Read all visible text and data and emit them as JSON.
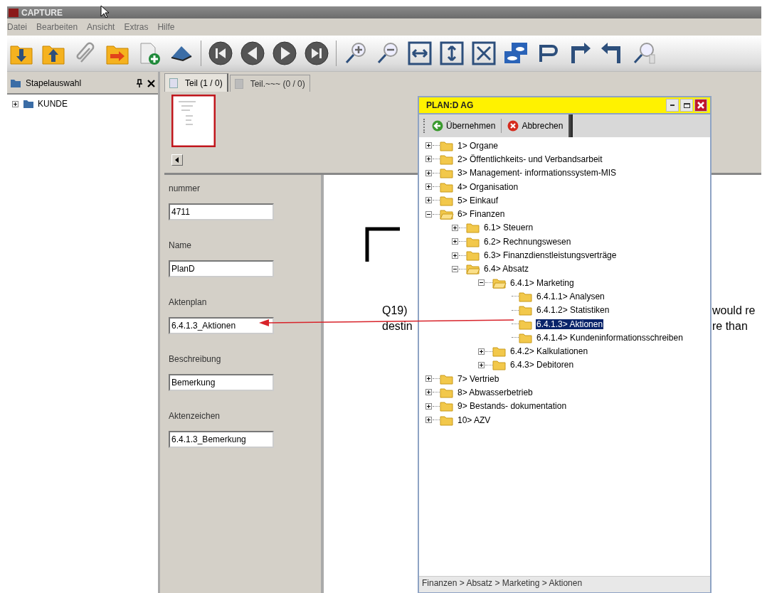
{
  "window": {
    "title": "CAPTURE"
  },
  "menu": [
    "Datei",
    "Bearbeiten",
    "Ansicht",
    "Extras",
    "Hilfe"
  ],
  "side_panel": {
    "title": "Stapelauswahl",
    "items": [
      {
        "label": "KUNDE",
        "expanded": false
      }
    ]
  },
  "tabs": [
    {
      "label": "Teil (1 / 0)",
      "selected": true
    },
    {
      "label": "Teil.~~~ (0 / 0)",
      "selected": false
    }
  ],
  "form": [
    {
      "label": "nummer",
      "value": "4711"
    },
    {
      "label": "Name",
      "value": "PlanD"
    },
    {
      "label": "Aktenplan",
      "value": "6.4.1.3_Aktionen"
    },
    {
      "label": "Beschreibung",
      "value": "Bemerkung"
    },
    {
      "label": "Aktenzeichen",
      "value": "6.4.1.3_Bemerkung"
    }
  ],
  "document": {
    "left_lines": [
      "Q19)",
      "destin"
    ],
    "right_lines": [
      "would re",
      "re than"
    ]
  },
  "dialog": {
    "title": "PLAN:D AG",
    "buttons": [
      {
        "label": "Übernehmen",
        "kind": "accept"
      },
      {
        "label": "Abbrechen",
        "kind": "cancel"
      }
    ],
    "tree": [
      {
        "label": "1> Organe",
        "expanded": false,
        "selected": false
      },
      {
        "label": "2> Öffentlichkeits- und Verbandsarbeit",
        "expanded": false,
        "selected": false
      },
      {
        "label": "3> Management- informationssystem-MIS",
        "expanded": false,
        "selected": false
      },
      {
        "label": "4> Organisation",
        "expanded": false,
        "selected": false
      },
      {
        "label": "5> Einkauf",
        "expanded": false,
        "selected": false
      },
      {
        "label": "6> Finanzen",
        "expanded": true,
        "selected": false,
        "children": [
          {
            "label": "6.1> Steuern",
            "expanded": false,
            "selected": false
          },
          {
            "label": "6.2> Rechnungswesen",
            "expanded": false,
            "selected": false
          },
          {
            "label": "6.3> Finanzdienstleistungsverträge",
            "expanded": false,
            "selected": false
          },
          {
            "label": "6.4> Absatz",
            "expanded": true,
            "selected": false,
            "children": [
              {
                "label": "6.4.1> Marketing",
                "expanded": true,
                "selected": false,
                "children": [
                  {
                    "label": "6.4.1.1> Analysen",
                    "selected": false
                  },
                  {
                    "label": "6.4.1.2> Statistiken",
                    "selected": false
                  },
                  {
                    "label": "6.4.1.3> Aktionen",
                    "selected": true
                  },
                  {
                    "label": "6.4.1.4> Kundeninformationsschreiben",
                    "selected": false
                  }
                ]
              },
              {
                "label": "6.4.2> Kalkulationen",
                "expanded": false,
                "selected": false
              },
              {
                "label": "6.4.3> Debitoren",
                "expanded": false,
                "selected": false
              }
            ]
          }
        ]
      },
      {
        "label": "7> Vertrieb",
        "expanded": false,
        "selected": false
      },
      {
        "label": "8> Abwasserbetrieb",
        "expanded": false,
        "selected": false
      },
      {
        "label": "9> Bestands- dokumentation",
        "expanded": false,
        "selected": false
      },
      {
        "label": "10> AZV",
        "expanded": false,
        "selected": false
      }
    ],
    "status": "Finanzen > Absatz > Marketing > Aktionen"
  }
}
